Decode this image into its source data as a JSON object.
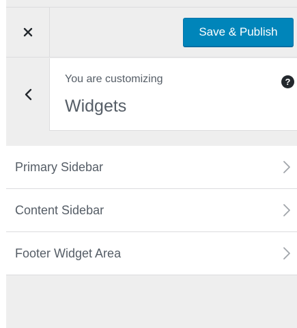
{
  "header": {
    "close_icon": "close-icon",
    "publish_label": "Save & Publish",
    "publish_color": "#0085ba"
  },
  "section": {
    "back_icon": "chevron-left-icon",
    "customizing_label": "You are customizing",
    "title": "Widgets",
    "help_icon": "help-icon",
    "help_glyph": "?"
  },
  "widget_areas": [
    {
      "label": "Primary Sidebar",
      "icon": "chevron-right-icon"
    },
    {
      "label": "Content Sidebar",
      "icon": "chevron-right-icon"
    },
    {
      "label": "Footer Widget Area",
      "icon": "chevron-right-icon"
    }
  ]
}
